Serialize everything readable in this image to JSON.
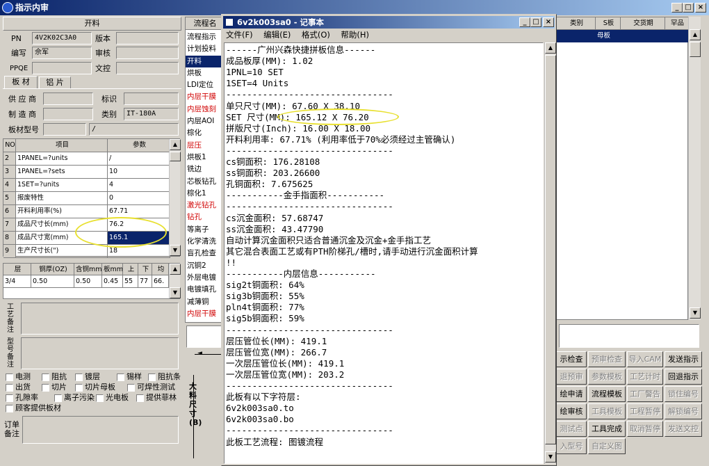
{
  "app": {
    "title": "指示内审"
  },
  "left": {
    "header": "开料",
    "pn_label": "PN",
    "pn_value": "4V2K02C3A0",
    "version_label": "版本",
    "version_value": "",
    "author_label": "编写",
    "author_value": "佘军",
    "review_label": "审核",
    "review_value": "",
    "ppqe_label": "PPQE",
    "ppqe_value": "",
    "ctrl_label": "文控",
    "ctrl_value": "",
    "tabs": [
      "板 材",
      "铝 片"
    ],
    "supplier_label": "供 应 商",
    "supplier_value": "",
    "mark_label": "标识",
    "mark_value": "",
    "maker_label": "制 造 商",
    "maker_value": "",
    "type_label": "类别",
    "type_value": "IT-180A",
    "model_label": "板材型号",
    "model_value": "",
    "model_value2": "/",
    "param_table": {
      "headers": [
        "NO",
        "项目",
        "参数"
      ],
      "rows": [
        [
          "2",
          "1PANEL=?units",
          "/"
        ],
        [
          "3",
          "1PANEL=?sets",
          "10"
        ],
        [
          "4",
          "1SET=?units",
          "4"
        ],
        [
          "5",
          "报废特性",
          "0"
        ],
        [
          "6",
          "开料利用率(%)",
          "67.71"
        ],
        [
          "7",
          "成品尺寸长(mm)",
          "76.2"
        ],
        [
          "8",
          "成品尺寸宽(mm)",
          "165.1"
        ],
        [
          "9",
          "生产尺寸长(\")",
          "18"
        ]
      ]
    },
    "layer_table": {
      "headers": [
        "层",
        "铜厚(OZ)",
        "含铜mm",
        "板mm",
        "上",
        "下",
        "均"
      ],
      "row": [
        "3/4",
        "0.50",
        "0.50",
        "0.45",
        "55",
        "77",
        "66."
      ]
    },
    "note1_label": "工艺备注",
    "note2_label": "型号备注",
    "checkboxes": [
      [
        "电测",
        "阻抗",
        "镀层",
        "锡样",
        "阻抗条"
      ],
      [
        "出货",
        "切片",
        "切片母板",
        "可焊性测试"
      ],
      [
        "孔隙率",
        "离子污染",
        "光电板",
        "提供菲林"
      ],
      [
        "顾客提供板材"
      ]
    ],
    "order_note_label": "订单备注"
  },
  "flow": {
    "header": "流程名",
    "items": [
      {
        "t": "流程指示",
        "red": false
      },
      {
        "t": "计划投料",
        "red": false
      },
      {
        "t": "开料",
        "red": true,
        "sel": true
      },
      {
        "t": "烘板",
        "red": false
      },
      {
        "t": "LDI定位",
        "red": false
      },
      {
        "t": "内层干膜",
        "red": true
      },
      {
        "t": "内层蚀刻",
        "red": true
      },
      {
        "t": "内层AOI",
        "red": false
      },
      {
        "t": "棕化",
        "red": false
      },
      {
        "t": "层压",
        "red": true
      },
      {
        "t": "烘板1",
        "red": false
      },
      {
        "t": "铣边",
        "red": false
      },
      {
        "t": "芯板钻孔",
        "red": false
      },
      {
        "t": "棕化1",
        "red": false
      },
      {
        "t": "激光钻孔",
        "red": true
      },
      {
        "t": "钻孔",
        "red": true
      },
      {
        "t": "等离子",
        "red": false
      },
      {
        "t": "化学清洗",
        "red": false
      },
      {
        "t": "盲孔检查",
        "red": false
      },
      {
        "t": "沉铜2",
        "red": false
      },
      {
        "t": "外层电镀",
        "red": false
      },
      {
        "t": "电镀填孔",
        "red": false
      },
      {
        "t": "减薄铜",
        "red": false
      },
      {
        "t": "内层干膜",
        "red": true
      }
    ],
    "dim_label": "大料尺寸(B)"
  },
  "right": {
    "headers": [
      "类别",
      "S板",
      "交货期",
      "罕品"
    ],
    "row": [
      "",
      "母板",
      "",
      ""
    ],
    "buttons": [
      [
        "示检查",
        "预审检查",
        "导入CAM",
        "发送指示"
      ],
      [
        "退预审",
        "参数模板",
        "工艺计时",
        "回退指示"
      ],
      [
        "绘申请",
        "流程模板",
        "工厂警告",
        "锁住编号"
      ],
      [
        "绘审核",
        "工具模板",
        "工程暂停",
        "解锁编号"
      ],
      [
        "测试点",
        "工具完成",
        "取消暂停",
        "发送文控"
      ],
      [
        "入型号",
        "自定义图",
        "",
        ""
      ]
    ],
    "enabled": [
      "发送指示",
      "回退指示",
      "工具完成",
      "流程模板",
      "示检查",
      "绘申请",
      "绘审核"
    ]
  },
  "notepad": {
    "title": "6v2k003sa0 - 记事本",
    "menu": [
      "文件(F)",
      "编辑(E)",
      "格式(O)",
      "帮助(H)"
    ],
    "lines": [
      "------广州兴森快捷拼板信息------",
      "成品板厚(MM): 1.02",
      "1PNL=10 SET",
      "1SET=4 Units",
      "--------------------------------",
      "单只尺寸(MM): 67.60 X 38.10",
      "SET 尺寸(MM): 165.12 X 76.20",
      "拼版尺寸(Inch): 16.00 X 18.00",
      "开料利用率: 67.71% (利用率低于70%必须经过主管确认)",
      "--------------------------------",
      "cs铜面积: 176.28108",
      "ss铜面积: 203.26600",
      "孔铜面积: 7.675625",
      "-----------金手指面积-----------",
      "--------------------------------",
      "cs沉金面积: 57.68747",
      "ss沉金面积: 43.47790",
      "自动计算沉金面积只适合普通沉金及沉金+金手指工艺",
      "其它混合表面工艺或有PTH阶梯孔/槽时,请手动进行沉金面积计算",
      "!!",
      "-----------内层信息-----------",
      "sig2t铜面积: 64%",
      "sig3b铜面积: 55%",
      "pln4t铜面积: 77%",
      "sig5b铜面积: 59%",
      "--------------------------------",
      "层压管位长(MM): 419.1",
      "层压管位宽(MM): 266.7",
      "一次层压管位长(MM): 419.1",
      "一次层压管位宽(MM): 203.2",
      "--------------------------------",
      "此板有以下字符层:",
      "6v2k003sa0.to",
      "6v2k003sa0.bo",
      "--------------------------------",
      "此板工艺流程: 图镀流程"
    ]
  },
  "colors": {
    "titlebar": "#0a246a",
    "selection": "#0a246a",
    "highlight": "#e8e030",
    "red_text": "#d00000"
  }
}
